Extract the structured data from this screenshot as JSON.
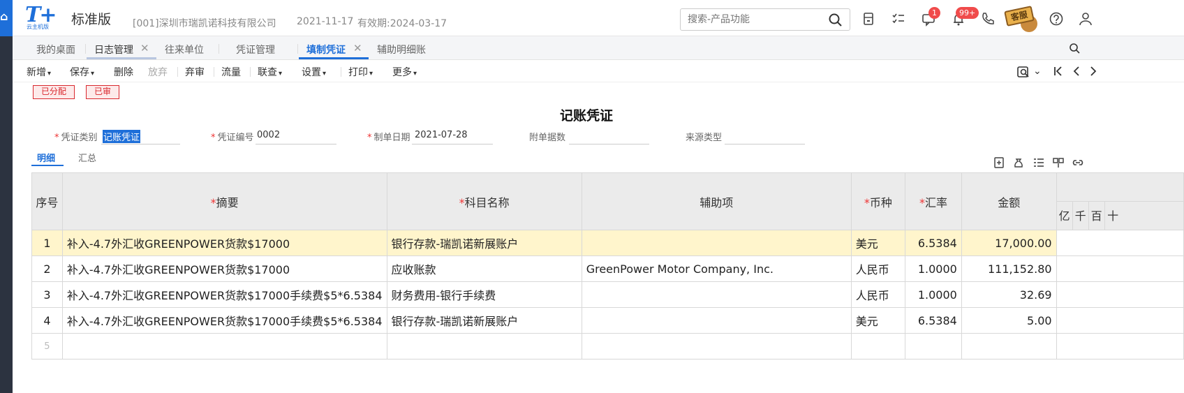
{
  "app": {
    "logo_text": "T+",
    "logo_sub": "云主机版",
    "edition": "标准版",
    "company": "[001]深圳市瑞凯诺科技有限公司",
    "date": "2021-11-17",
    "valid": "有效期:2024-03-17",
    "search_placeholder": "搜索-产品功能",
    "badge_msg": "1",
    "badge_notice": "99+",
    "kefu": "客服"
  },
  "tabs": [
    {
      "label": "我的桌面"
    },
    {
      "label": "日志管理"
    },
    {
      "label": "往来单位"
    },
    {
      "label": "凭证管理"
    },
    {
      "label": "填制凭证"
    },
    {
      "label": "辅助明细账"
    }
  ],
  "toolbar": {
    "new": "新增",
    "save": "保存",
    "delete": "删除",
    "discard": "放弃",
    "unaudit": "弃审",
    "flow": "流量",
    "linkcheck": "联查",
    "settings": "设置",
    "print": "打印",
    "more": "更多"
  },
  "stamps": {
    "allocated": "已分配",
    "audited": "已审"
  },
  "voucher": {
    "title": "记账凭证",
    "type_label": "凭证类别",
    "type_value": "记账凭证",
    "no_label": "凭证编号",
    "no_value": "0002",
    "date_label": "制单日期",
    "date_value": "2021-07-28",
    "attach_label": "附单据数",
    "source_label": "来源类型"
  },
  "subtabs": {
    "detail": "明细",
    "summary": "汇总"
  },
  "table": {
    "headers": {
      "seq": "序号",
      "summary": "摘要",
      "account": "科目名称",
      "aux": "辅助项",
      "currency": "币种",
      "rate": "汇率",
      "amount": "金额"
    },
    "units": [
      "亿",
      "千",
      "百",
      "十"
    ],
    "rows": [
      {
        "seq": "1",
        "summary": "补入-4.7外汇收GREENPOWER货款$17000",
        "account": "银行存款-瑞凯诺新展账户",
        "aux": "",
        "currency": "美元",
        "rate": "6.5384",
        "amount": "17,000.00"
      },
      {
        "seq": "2",
        "summary": "补入-4.7外汇收GREENPOWER货款$17000",
        "account": "应收账款",
        "aux": "GreenPower Motor Company, Inc.",
        "currency": "人民币",
        "rate": "1.0000",
        "amount": "111,152.80"
      },
      {
        "seq": "3",
        "summary": "补入-4.7外汇收GREENPOWER货款$17000手续费$5*6.5384",
        "account": "财务费用-银行手续费",
        "aux": "",
        "currency": "人民币",
        "rate": "1.0000",
        "amount": "32.69"
      },
      {
        "seq": "4",
        "summary": "补入-4.7外汇收GREENPOWER货款$17000手续费$5*6.5384",
        "account": "银行存款-瑞凯诺新展账户",
        "aux": "",
        "currency": "美元",
        "rate": "6.5384",
        "amount": "5.00"
      },
      {
        "seq": "5",
        "summary": "",
        "account": "",
        "aux": "",
        "currency": "",
        "rate": "",
        "amount": ""
      }
    ]
  }
}
